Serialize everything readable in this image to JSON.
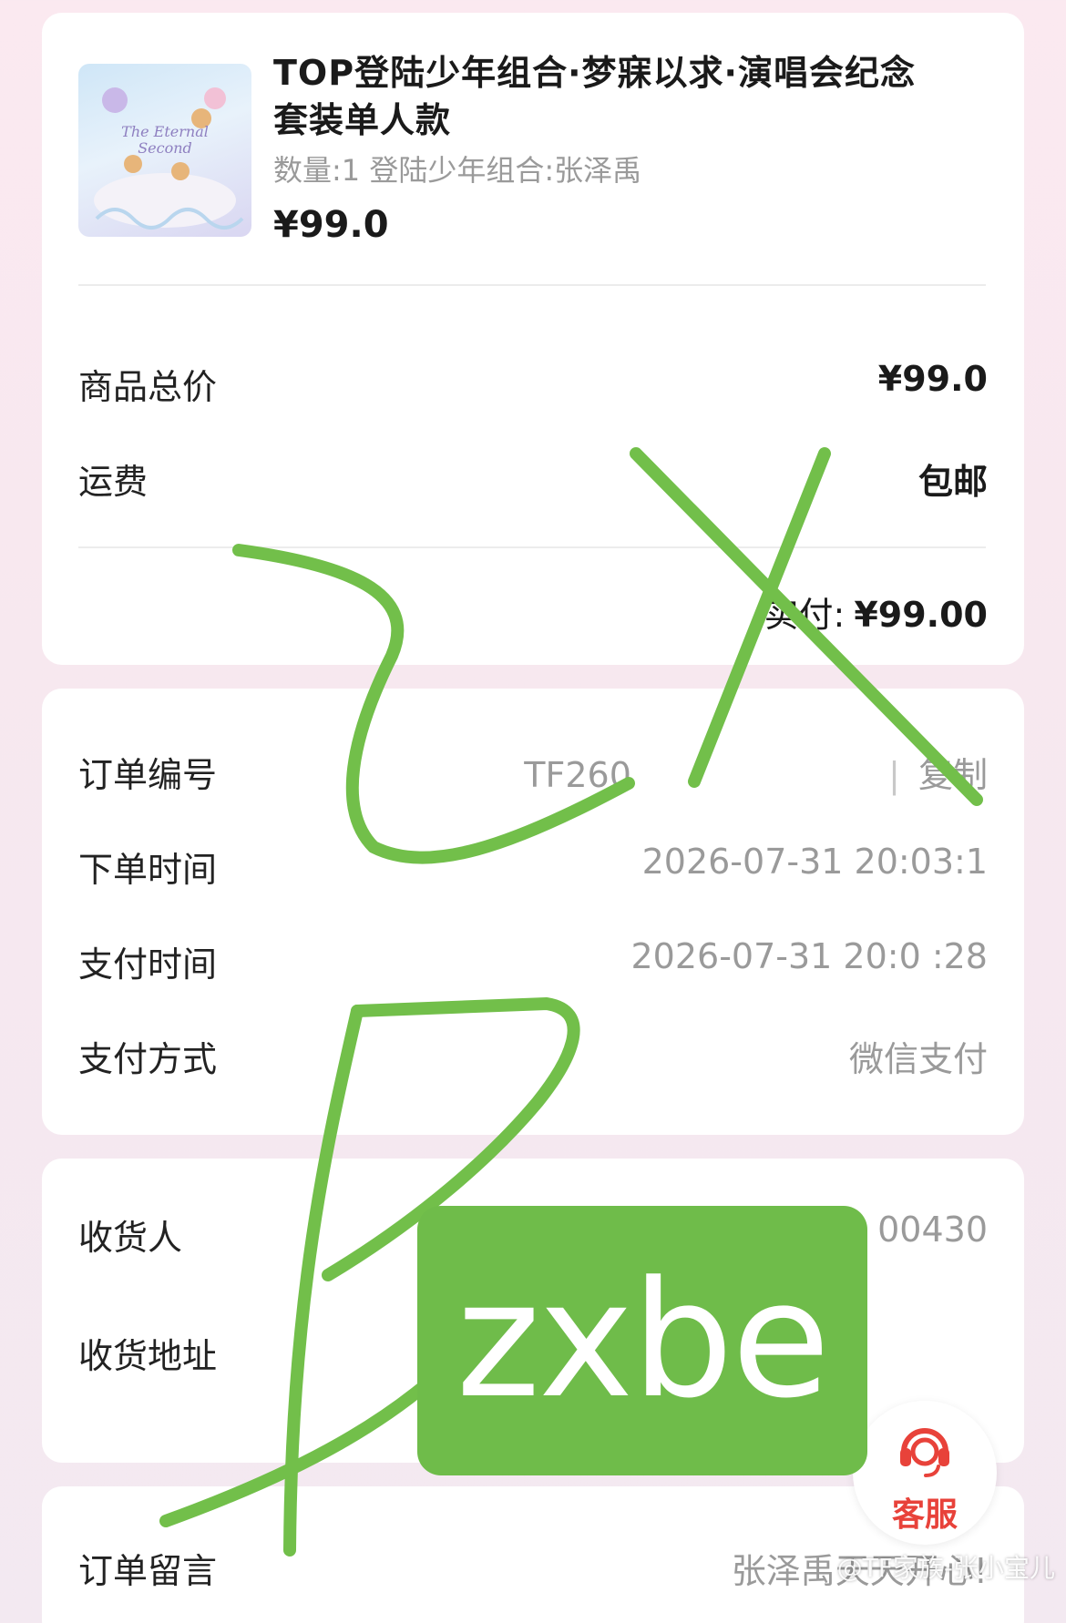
{
  "product": {
    "title": "TOP登陆少年组合·梦寐以求·演唱会纪念套装单人款",
    "spec": "数量:1 登陆少年组合:张泽禹",
    "price": "¥99.0",
    "cover_text": "The Eternal Second"
  },
  "price_summary": {
    "subtotal_label": "商品总价",
    "subtotal_value": "¥99.0",
    "shipping_label": "运费",
    "shipping_value": "包邮",
    "paid_label": "实付:",
    "paid_value": "¥99.00"
  },
  "order_info": {
    "number_label": "订单编号",
    "number_value": "TF260",
    "copy_label": "复制",
    "created_label": "下单时间",
    "created_value": "2026-07-31 20:03:1",
    "paid_time_label": "支付时间",
    "paid_time_value": "2026-07-31 20:0 :28",
    "method_label": "支付方式",
    "method_value": "微信支付"
  },
  "address": {
    "receiver_label": "收货人",
    "receiver_value": "00430",
    "address_label": "收货地址",
    "address_value": ""
  },
  "note": {
    "label": "订单留言",
    "value": "张泽禹天天开心!"
  },
  "service": {
    "label": "客服",
    "icon": "headset-icon",
    "color": "#e8423a"
  },
  "overlay": {
    "sticker_text": "zxbe",
    "sticker_color": "#6fbc4a",
    "scribble_color": "#72bf4a"
  },
  "watermark": "@TF家族-张小宝儿"
}
